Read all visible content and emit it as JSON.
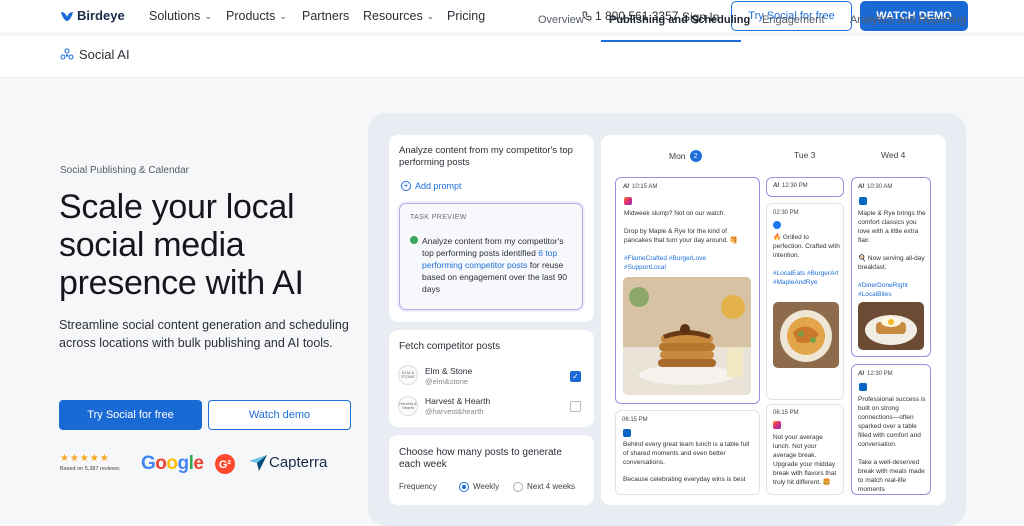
{
  "nav": {
    "brand": "Birdeye",
    "links": [
      "Solutions",
      "Products",
      "Partners",
      "Resources",
      "Pricing"
    ],
    "phone": "1 800 561 3357",
    "signin": "Sign In",
    "try_button": "Try Social for free",
    "watch_button": "WATCH DEMO",
    "brand_color": "#1a6ad6"
  },
  "subnav": {
    "title": "Social AI",
    "tabs": [
      "Overview",
      "Publishing and Scheduling",
      "Engagement",
      "Analytics and Reporting"
    ],
    "active_tab": "Publishing and Scheduling"
  },
  "hero": {
    "eyebrow": "Social Publishing & Calendar",
    "headline": "Scale your local social media presence with AI",
    "subtitle": "Streamline social content generation and scheduling across locations with bulk publishing and AI tools.",
    "primary_cta": "Try Social for free",
    "secondary_cta": "Watch demo",
    "stars": "★★★★★",
    "reviews_text": "Based on 5,387 reviews:",
    "ratings": [
      "Google",
      "G2",
      "Capterra"
    ]
  },
  "prompt_card": {
    "title": "Analyze content from my competitor's top performing posts",
    "add_prompt": "Add prompt",
    "task_label": "TASK PREVIEW",
    "task_text_1": "Analyze content from my competitor's top performing posts identified ",
    "task_highlight": "6 top performing competitor posts",
    "task_text_2": " for reuse based on engagement over the last 90 days"
  },
  "competitor_card": {
    "title": "Fetch competitor posts",
    "items": [
      {
        "logo": "ELM & STONE",
        "name": "Elm & Stone",
        "handle": "@elm&stone",
        "checked": true
      },
      {
        "logo": "Harvest & Hearth",
        "name": "Harvest & Hearth",
        "handle": "@harvest&hearth",
        "checked": false
      }
    ]
  },
  "frequency_card": {
    "title": "Choose how many posts to generate each week",
    "label": "Frequency",
    "options": [
      "Weekly",
      "Next 4 weeks"
    ],
    "selected": "Weekly"
  },
  "calendar": {
    "days": [
      {
        "name": "Mon",
        "badge": "2"
      },
      {
        "name": "Tue 3",
        "badge": ""
      },
      {
        "name": "Wed 4",
        "badge": ""
      }
    ],
    "posts": {
      "mon_1": {
        "time": "10:15 AM",
        "text": "Midweek slump? Not on our watch.",
        "text2": "Drop by Maple & Rye for the kind of pancakes that turn your day around. 🥞",
        "tags": "#FlameCrafted #BurgerLove #SupportLocal"
      },
      "mon_2": {
        "time": "06:15 PM",
        "text": "Behind every great team lunch is a table full of shared moments and even better conversations.",
        "text2": "Because celebrating everyday wins is best"
      },
      "tue_1": {
        "time": "12:30 PM"
      },
      "tue_2": {
        "time": "02:30 PM",
        "text": "🔥 Grilled to perfection. Crafted with intention.",
        "tags": "#LocalEats #BurgerArt #MapleAndRye"
      },
      "tue_3": {
        "time": "06:15 PM",
        "text": "Not your average lunch. Not your average break. Upgrade your midday break with flavors that truly hit different. 🍔"
      },
      "wed_1": {
        "time": "10:30 AM",
        "text": "Maple & Rye brings the comfort classics you love with a little extra flair.",
        "text2": "🍳 Now serving all-day breakfast.",
        "tags": "#DinerDoneRight #LocalBites"
      },
      "wed_2": {
        "time": "12:30 PM",
        "text": "Professional success is built on strong connections—often sparked over a table filled with comfort and conversation.",
        "text2": "Take a well-deserved break with meals made to match real-life moments"
      }
    }
  }
}
